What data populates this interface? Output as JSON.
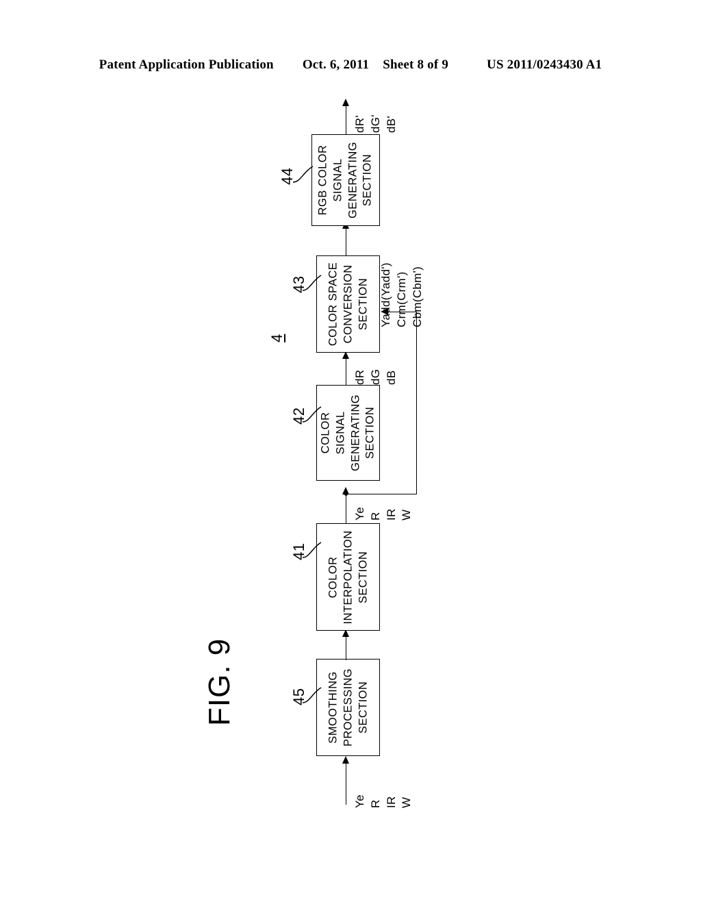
{
  "header": {
    "publication": "Patent Application Publication",
    "date": "Oct. 6, 2011",
    "sheet": "Sheet 8 of 9",
    "document_number": "US 2011/0243430 A1"
  },
  "figure": {
    "title": "FIG. 9",
    "system_numeral": "4",
    "blocks": [
      {
        "ref": "45",
        "lines": [
          "SMOOTHING",
          "PROCESSING",
          "SECTION"
        ],
        "name": "smoothing-processing-section"
      },
      {
        "ref": "41",
        "lines": [
          "COLOR",
          "INTERPOLATION",
          "SECTION"
        ],
        "name": "color-interpolation-section"
      },
      {
        "ref": "42",
        "lines": [
          "COLOR",
          "SIGNAL",
          "GENERATING",
          "SECTION"
        ],
        "name": "color-signal-generating-section"
      },
      {
        "ref": "43",
        "lines": [
          "COLOR SPACE",
          "CONVERSION",
          "SECTION"
        ],
        "name": "color-space-conversion-section"
      },
      {
        "ref": "44",
        "lines": [
          "RGB COLOR",
          "SIGNAL",
          "GENERATING",
          "SECTION"
        ],
        "name": "rgb-color-signal-generating-section"
      }
    ],
    "signals": {
      "input": [
        "Ye",
        "R",
        "IR",
        "W"
      ],
      "interp_out": [
        "Ye",
        "R",
        "IR",
        "W"
      ],
      "color_out": [
        "dR",
        "dG",
        "dB"
      ],
      "feedback": [
        "Yadd(Yadd')",
        "Crm(Crm')",
        "Cbm(Cbm')"
      ],
      "output": [
        "dR'",
        "dG'",
        "dB'"
      ]
    }
  },
  "colors": {
    "ink": "#000000",
    "paper": "#ffffff"
  }
}
